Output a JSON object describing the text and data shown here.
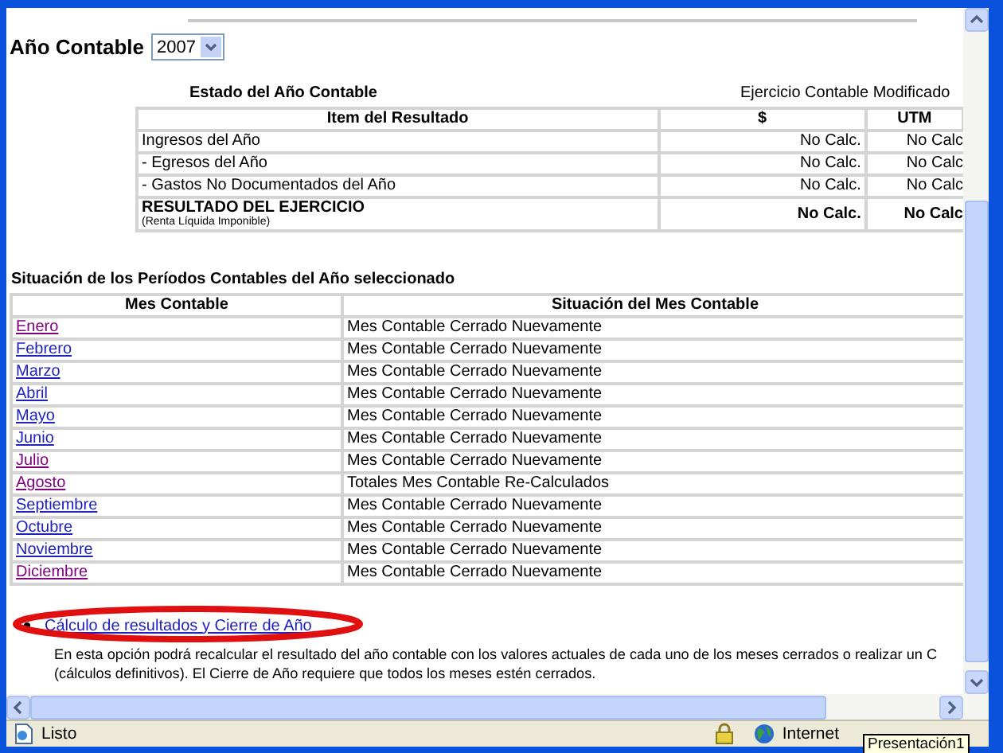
{
  "year_selector": {
    "label": "Año Contable",
    "value": "2007"
  },
  "summary": {
    "title": "Estado del Año Contable",
    "status": "Ejercicio Contable Modificado",
    "columns": [
      "Item del Resultado",
      "$",
      "UTM"
    ],
    "rows": [
      {
        "kind": "line",
        "item": "Ingresos del Año",
        "amount": "No Calc.",
        "utm": "No Calc"
      },
      {
        "kind": "line",
        "item": "- Egresos del Año",
        "amount": "No Calc.",
        "utm": "No Calc"
      },
      {
        "kind": "line",
        "item": "- Gastos No Documentados del Año",
        "amount": "No Calc.",
        "utm": "No Calc"
      },
      {
        "kind": "total",
        "item": "RESULTADO DEL EJERCICIO",
        "note": "(Renta Líquida Imponible)",
        "amount": "No Calc.",
        "utm": "No Calc"
      }
    ]
  },
  "periods": {
    "title": "Situación de los Períodos Contables del Año seleccionado",
    "columns": [
      "Mes Contable",
      "Situación del Mes Contable"
    ],
    "rows": [
      {
        "month": "Enero",
        "visited": true,
        "status": "Mes Contable Cerrado Nuevamente"
      },
      {
        "month": "Febrero",
        "visited": false,
        "status": "Mes Contable Cerrado Nuevamente"
      },
      {
        "month": "Marzo",
        "visited": false,
        "status": "Mes Contable Cerrado Nuevamente"
      },
      {
        "month": "Abril",
        "visited": false,
        "status": "Mes Contable Cerrado Nuevamente"
      },
      {
        "month": "Mayo",
        "visited": false,
        "status": "Mes Contable Cerrado Nuevamente"
      },
      {
        "month": "Junio",
        "visited": false,
        "status": "Mes Contable Cerrado Nuevamente"
      },
      {
        "month": "Julio",
        "visited": true,
        "status": "Mes Contable Cerrado Nuevamente"
      },
      {
        "month": "Agosto",
        "visited": true,
        "status": "Totales Mes Contable Re-Calculados"
      },
      {
        "month": "Septiembre",
        "visited": false,
        "status": "Mes Contable Cerrado Nuevamente"
      },
      {
        "month": "Octubre",
        "visited": false,
        "status": "Mes Contable Cerrado Nuevamente"
      },
      {
        "month": "Noviembre",
        "visited": false,
        "status": "Mes Contable Cerrado Nuevamente"
      },
      {
        "month": "Diciembre",
        "visited": true,
        "status": "Mes Contable Cerrado Nuevamente"
      }
    ]
  },
  "option": {
    "link": "Cálculo de resultados y Cierre de Año",
    "highlighted": true,
    "description": [
      "En esta opción podrá recalcular el resultado del año contable con los valores actuales de cada uno de los meses cerrados o realizar un C",
      "(cálculos definitivos). El Cierre de Año requiere que todos los meses estén cerrados."
    ]
  },
  "status_bar": {
    "text": "Listo",
    "zone": "Internet",
    "tooltip": "Presentación1"
  }
}
